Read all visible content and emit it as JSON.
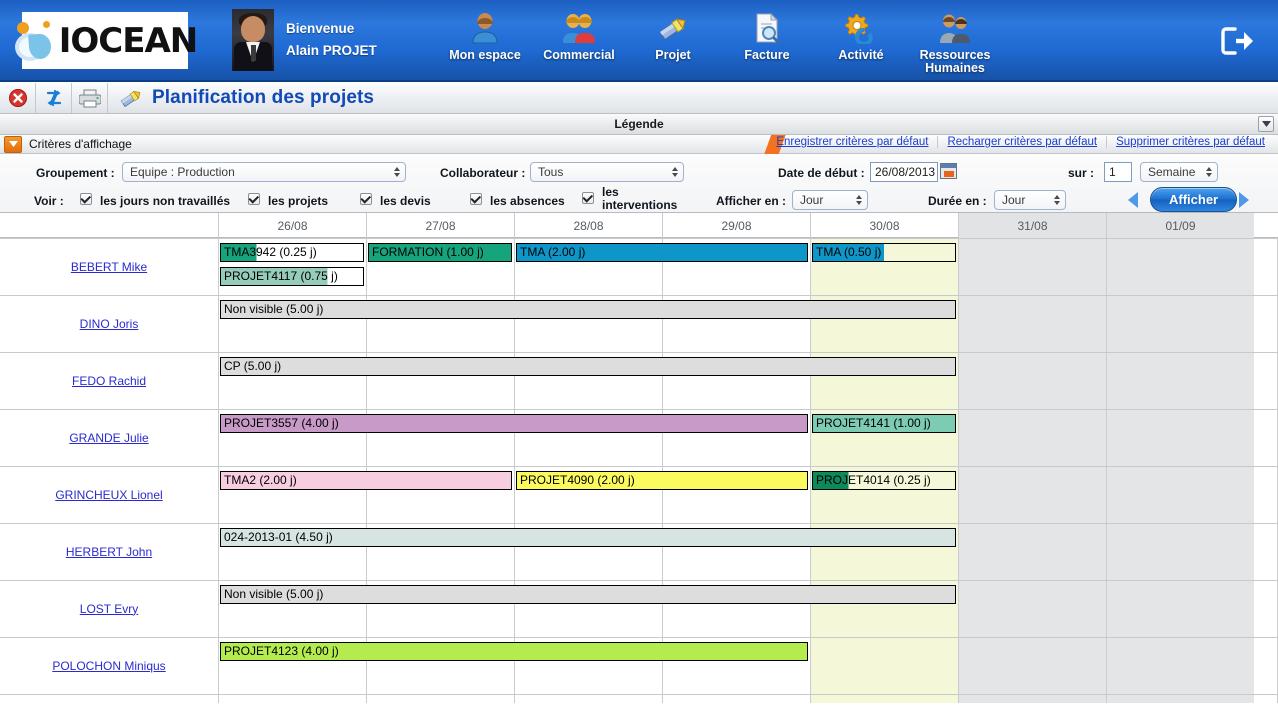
{
  "header": {
    "logo_text": "IOCEAN",
    "welcome_line1": "Bienvenue",
    "welcome_line2": "Alain PROJET",
    "nav": [
      {
        "label": "Mon espace",
        "icon": "user-icon"
      },
      {
        "label": "Commercial",
        "icon": "users-icon"
      },
      {
        "label": "Projet",
        "icon": "paintbrush-icon"
      },
      {
        "label": "Facture",
        "icon": "document-search-icon"
      },
      {
        "label": "Activité",
        "icon": "gear-refresh-icon"
      },
      {
        "label": "Ressources\nHumaines",
        "icon": "people-icon"
      }
    ],
    "logout_icon": "logout-icon"
  },
  "toolbar": {
    "close_icon": "close-icon",
    "refresh_icon": "refresh-icon",
    "print_icon": "print-icon",
    "title_icon": "paintbrush-icon",
    "title": "Planification des projets"
  },
  "legend": {
    "label": "Légende",
    "toggle_icon": "chevron-down-icon"
  },
  "criteria": {
    "toggle_icon": "triangle-down-icon",
    "title": "Critères d'affichage",
    "links": [
      "Enregistrer critères par défaut",
      "Recharger critères par défaut",
      "Supprimer critères par défaut"
    ],
    "groupement_label": "Groupement :",
    "groupement_value": "Equipe : Production",
    "collaborateur_label": "Collaborateur :",
    "collaborateur_value": "Tous",
    "date_debut_label": "Date de début :",
    "date_debut_value": "26/08/2013",
    "calendar_icon": "calendar-icon",
    "sur_label": "sur :",
    "sur_value": "1",
    "sur_unit": "Semaine",
    "voir_label": "Voir :",
    "checkboxes": [
      {
        "label": "les jours non travaillés",
        "checked": true
      },
      {
        "label": "les projets",
        "checked": true
      },
      {
        "label": "les devis",
        "checked": true
      },
      {
        "label": "les absences",
        "checked": true
      },
      {
        "label": "les interventions",
        "checked": true
      }
    ],
    "afficher_en_label": "Afficher en :",
    "afficher_en_value": "Jour",
    "duree_en_label": "Durée en :",
    "duree_en_value": "Jour",
    "prev_icon": "arrow-left-icon",
    "afficher_button": "Afficher",
    "next_icon": "arrow-right-icon"
  },
  "gantt": {
    "columns": [
      {
        "label": "26/08",
        "weekend": false,
        "today": false
      },
      {
        "label": "27/08",
        "weekend": false,
        "today": false
      },
      {
        "label": "28/08",
        "weekend": false,
        "today": false
      },
      {
        "label": "29/08",
        "weekend": false,
        "today": false
      },
      {
        "label": "30/08",
        "weekend": false,
        "today": true
      },
      {
        "label": "31/08",
        "weekend": true,
        "today": false
      },
      {
        "label": "01/09",
        "weekend": true,
        "today": false
      }
    ],
    "rows": [
      {
        "name": "BEBERT Mike",
        "bars": [
          {
            "label": "TMA3942 (0.25 j)",
            "start": 0,
            "span": 1,
            "lane": 0,
            "color": "#ffffff",
            "fill_color": "#16a47c",
            "fill_pct": 25
          },
          {
            "label": "FORMATION (1.00 j)",
            "start": 1,
            "span": 1,
            "lane": 0,
            "color": "#16a47c",
            "fill_color": "#16a47c",
            "fill_pct": 100
          },
          {
            "label": "TMA (2.00 j)",
            "start": 2,
            "span": 2,
            "lane": 0,
            "color": "#0e96c9",
            "fill_color": "#0e96c9",
            "fill_pct": 100
          },
          {
            "label": "TMA (0.50 j)",
            "start": 4,
            "span": 1,
            "lane": 0,
            "color": "#f4f7d8",
            "fill_color": "#0e96c9",
            "fill_pct": 50
          },
          {
            "label": "PROJET4117 (0.75 j)",
            "start": 0,
            "span": 1,
            "lane": 1,
            "color": "#ffffff",
            "fill_color": "#96ccba",
            "fill_pct": 75
          }
        ]
      },
      {
        "name": "DINO Joris",
        "bars": [
          {
            "label": "Non visible (5.00 j)",
            "start": 0,
            "span": 5,
            "lane": 0,
            "color": "#dddddd",
            "fill_color": "#dddddd",
            "fill_pct": 100
          }
        ]
      },
      {
        "name": "FEDO Rachid",
        "bars": [
          {
            "label": "CP (5.00 j)",
            "start": 0,
            "span": 5,
            "lane": 0,
            "color": "#dddddd",
            "fill_color": "#dddddd",
            "fill_pct": 100
          }
        ]
      },
      {
        "name": "GRANDE Julie",
        "bars": [
          {
            "label": "PROJET3557 (4.00 j)",
            "start": 0,
            "span": 4,
            "lane": 0,
            "color": "#c79ac8",
            "fill_color": "#c79ac8",
            "fill_pct": 100
          },
          {
            "label": "PROJET4141 (1.00 j)",
            "start": 4,
            "span": 1,
            "lane": 0,
            "color": "#7ecbb4",
            "fill_color": "#7ecbb4",
            "fill_pct": 100
          }
        ]
      },
      {
        "name": "GRINCHEUX Lionel",
        "bars": [
          {
            "label": "TMA2 (2.00 j)",
            "start": 0,
            "span": 2,
            "lane": 0,
            "color": "#f7cde0",
            "fill_color": "#f7cde0",
            "fill_pct": 100
          },
          {
            "label": "PROJET4090 (2.00 j)",
            "start": 2,
            "span": 2,
            "lane": 0,
            "color": "#fbfb60",
            "fill_color": "#fbfb60",
            "fill_pct": 100
          },
          {
            "label": "PROJET4014 (0.25 j)",
            "start": 4,
            "span": 1,
            "lane": 0,
            "color": "#f4f7d8",
            "fill_color": "#0d8a5a",
            "fill_pct": 25
          }
        ]
      },
      {
        "name": "HERBERT John",
        "bars": [
          {
            "label": "024-2013-01 (4.50 j)",
            "start": 0,
            "span": 5,
            "lane": 0,
            "color": "#d6e5e2",
            "fill_color": "#d6e5e2",
            "fill_pct": 100
          }
        ]
      },
      {
        "name": "LOST Evry",
        "bars": [
          {
            "label": "Non visible (5.00 j)",
            "start": 0,
            "span": 5,
            "lane": 0,
            "color": "#dddddd",
            "fill_color": "#dddddd",
            "fill_pct": 100
          }
        ]
      },
      {
        "name": "POLOCHON Miniqus",
        "bars": [
          {
            "label": "PROJET4123 (4.00 j)",
            "start": 0,
            "span": 4,
            "lane": 0,
            "color": "#b4ec50",
            "fill_color": "#b4ec50",
            "fill_pct": 100
          }
        ]
      }
    ]
  },
  "colors": {
    "brand_blue": "#1f6ad3",
    "link_blue": "#2a2ad0",
    "title_blue": "#1149b7",
    "accent_orange": "#f4711f",
    "weekend_grey": "#e4e5e6",
    "today_yellow": "#f4f7d8"
  }
}
